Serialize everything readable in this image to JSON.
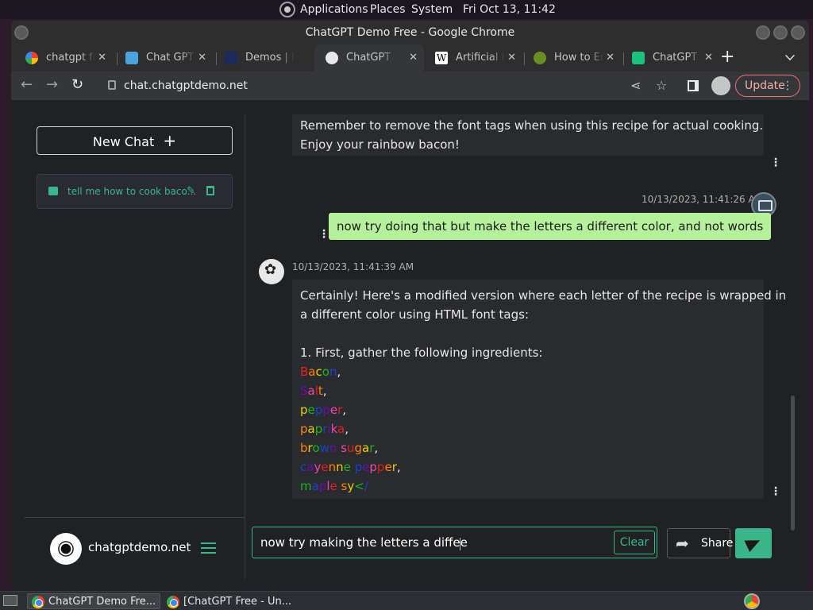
{
  "top_panel": {
    "applications": "Applications",
    "places": "Places",
    "system": "System",
    "clock": "Fri Oct 13, 11:42"
  },
  "window": {
    "title": "ChatGPT Demo Free - Google Chrome"
  },
  "tabs": [
    {
      "label": "chatgpt free",
      "icon": "google-icon"
    },
    {
      "label": "Chat GPT C",
      "icon": "chat-icon"
    },
    {
      "label": "Demos | In",
      "icon": "demos-icon"
    },
    {
      "label": "ChatGPT D",
      "icon": "chatgpt-demo-icon"
    },
    {
      "label": "Artificial in",
      "icon": "wikipedia-icon"
    },
    {
      "label": "How to En",
      "icon": "howto-icon"
    },
    {
      "label": "ChatGPT F",
      "icon": "openai-icon"
    }
  ],
  "toolbar": {
    "url": "chat.chatgptdemo.net",
    "update_label": "Update"
  },
  "sidebar": {
    "new_chat_label": "New Chat",
    "conversations": [
      {
        "title": "tell me how to cook baco..."
      }
    ],
    "site_name": "chatgptdemo.net"
  },
  "messages": {
    "ai_prev": {
      "lines": [
        "Remember to remove the font tags when using this recipe for actual cooking.",
        "Enjoy your rainbow bacon!"
      ]
    },
    "user": {
      "timestamp": "10/13/2023, 11:41:26 AM",
      "text": "now try doing that but make the letters a different color, and not words"
    },
    "ai": {
      "timestamp": "10/13/2023, 11:41:39 AM",
      "intro_1": "Certainly! Here's a modified version where each letter of the recipe is wrapped in",
      "intro_2": "a different color using HTML font tags:",
      "step": "1. First, gather the following ingredients:",
      "colored_lines": [
        "Bacon,",
        "Salt,",
        "pepper,",
        "paprika,",
        "brown sugar,",
        "cayenne pepper,",
        "maple sy</"
      ]
    }
  },
  "composer": {
    "input_value": "now try making the letters a diffee",
    "clear_label": "Clear",
    "share_label": "Share"
  },
  "taskbar": {
    "items": [
      {
        "label": "ChatGPT Demo Fre..."
      },
      {
        "label": "[ChatGPT Free - Un..."
      }
    ]
  },
  "colors": {
    "accent": "#3ab68a",
    "user_bubble": "#b5f09b",
    "rainbow": [
      "#e0201e",
      "#ff7f00",
      "#e8d000",
      "#1db31d",
      "#1e40c8",
      "#6a0dad",
      "#ee44aa"
    ]
  }
}
